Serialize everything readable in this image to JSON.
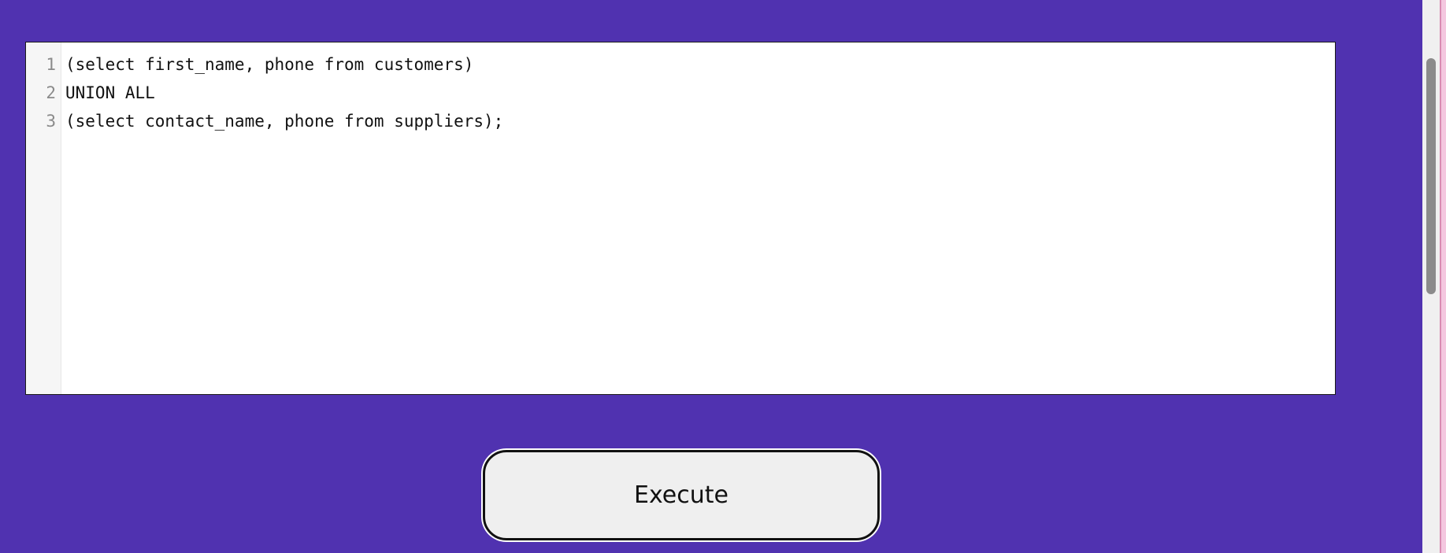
{
  "editor": {
    "line_numbers": [
      "1",
      "2",
      "3"
    ],
    "lines": [
      "(select first_name, phone from customers)",
      "UNION ALL",
      "(select contact_name, phone from suppliers);"
    ]
  },
  "actions": {
    "execute_label": "Execute"
  },
  "colors": {
    "background": "#5032b0",
    "editor_background": "#ffffff",
    "button_background": "#efefef"
  }
}
